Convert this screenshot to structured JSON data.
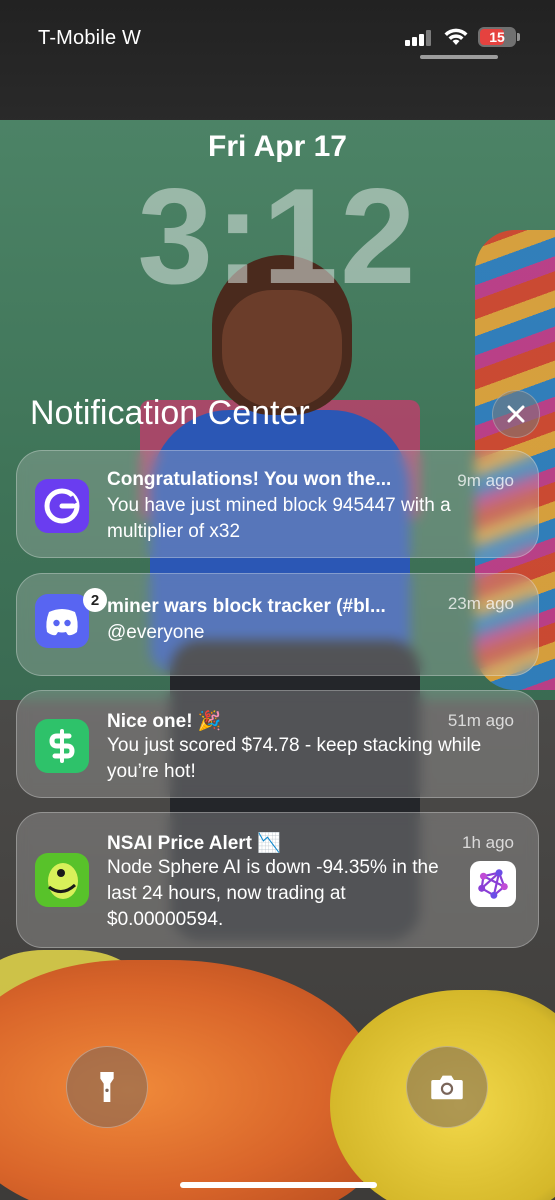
{
  "status_bar": {
    "carrier": "T-Mobile W",
    "battery_level": "15",
    "battery_color": "#e5423f"
  },
  "lock_screen": {
    "date": "Fri Apr 17",
    "time": "3:12"
  },
  "notification_center": {
    "title": "Notification Center",
    "close_icon": "close-icon"
  },
  "notifications": [
    {
      "app_icon": "mining-app-icon",
      "icon_color": "#6a3df0",
      "title": "Congratulations! You won the...",
      "time": "9m ago",
      "body": "You have just mined block 945447 with a multiplier of x32"
    },
    {
      "app_icon": "discord-icon",
      "icon_color": "#5865f2",
      "badge": "2",
      "title": "miner wars block tracker (#bl...",
      "time": "23m ago",
      "body": "@everyone"
    },
    {
      "app_icon": "cash-app-icon",
      "icon_color": "#2ec26a",
      "title": "Nice one! 🎉",
      "time": "51m ago",
      "body": "You just scored $74.78 - keep stacking while you’re hot!"
    },
    {
      "app_icon": "price-alert-app-icon",
      "icon_color": "#58c22a",
      "title": "NSAI Price Alert 📉",
      "time": "1h ago",
      "body": "Node Sphere AI is down -94.35% in the last 24 hours, now trading at $0.00000594.",
      "thumbnail": "node-sphere-logo-icon"
    }
  ],
  "controls": {
    "left": "flashlight-icon",
    "right": "camera-icon"
  }
}
